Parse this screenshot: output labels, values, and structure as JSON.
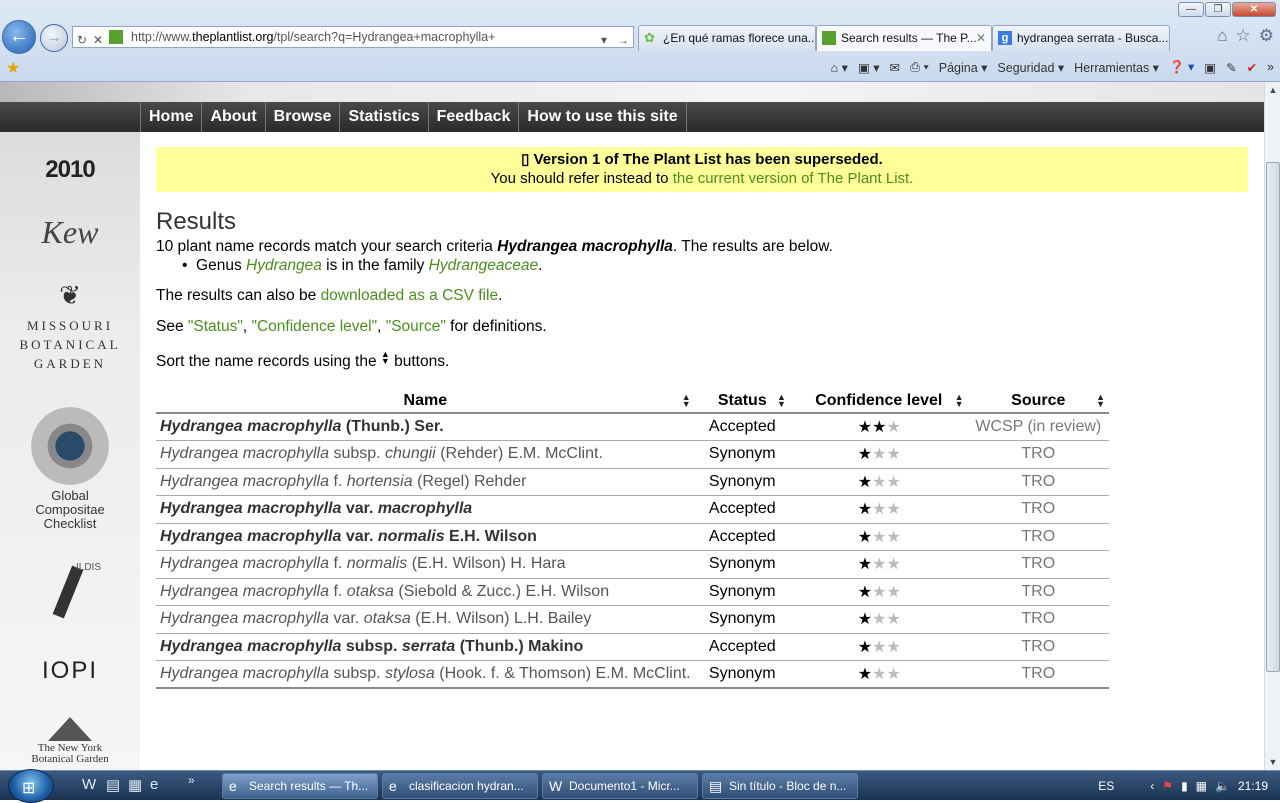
{
  "browser": {
    "url_prefix": "http://www.",
    "url_domain": "theplantlist.org",
    "url_path": "/tpl/search?q=Hydrangea+macrophylla+",
    "tabs": [
      {
        "title": "¿En qué ramas florece una..."
      },
      {
        "title": "Search results — The P...",
        "active": true
      },
      {
        "title": "hydrangea serrata - Busca..."
      }
    ],
    "commands": [
      "Página",
      "Seguridad",
      "Herramientas"
    ]
  },
  "nav": {
    "items": [
      "Home",
      "About",
      "Browse",
      "Statistics",
      "Feedback",
      "How to use this site"
    ]
  },
  "sidebar": {
    "logo_2010": "2010",
    "logo_kew": "Kew",
    "logo_missouri_1": "Missouri",
    "logo_missouri_2": "Botanical",
    "logo_missouri_3": "Garden",
    "logo_gcc": "Global Compositae Checklist",
    "logo_ildis": "ILDIS",
    "logo_iopi": "IOPI",
    "logo_nybg_1": "The New York",
    "logo_nybg_2": "Botanical Garden"
  },
  "notice": {
    "line1": "Version 1 of The Plant List has been superseded.",
    "line2_prefix": "You should refer instead to ",
    "line2_link": "the current version of The Plant List."
  },
  "results": {
    "heading": "Results",
    "summary_prefix": "10 plant name records match your search criteria ",
    "summary_query": "Hydrangea macrophylla",
    "summary_suffix": ". The results are below.",
    "bullet_prefix": "Genus ",
    "bullet_genus": "Hydrangea",
    "bullet_middle": " is in the family ",
    "bullet_family": "Hydrangeaceae",
    "bullet_suffix": ".",
    "csv_prefix": "The results can also be ",
    "csv_link": "downloaded as a CSV file",
    "csv_suffix": ".",
    "see_prefix": "See ",
    "def_status": "\"Status\"",
    "def_sep1": ", ",
    "def_confidence": "\"Confidence level\"",
    "def_sep2": ", ",
    "def_source": "\"Source\"",
    "see_suffix": " for definitions.",
    "sort_prefix": "Sort the name records using the ",
    "sort_suffix": " buttons."
  },
  "table": {
    "headers": {
      "name": "Name",
      "status": "Status",
      "confidence": "Confidence level",
      "source": "Source"
    },
    "rows": [
      {
        "genus_sp": "Hydrangea macrophylla",
        "rank": "",
        "infra": "",
        "author": "(Thunb.) Ser.",
        "status": "Accepted",
        "stars": 2,
        "source": "WCSP (in review)"
      },
      {
        "genus_sp": "Hydrangea macrophylla",
        "rank": "subsp.",
        "infra": "chungii",
        "author": "(Rehder) E.M. McClint.",
        "status": "Synonym",
        "stars": 1,
        "source": "TRO"
      },
      {
        "genus_sp": "Hydrangea macrophylla",
        "rank": "f.",
        "infra": "hortensia",
        "author": "(Regel) Rehder",
        "status": "Synonym",
        "stars": 1,
        "source": "TRO"
      },
      {
        "genus_sp": "Hydrangea macrophylla",
        "rank": "var.",
        "infra": "macrophylla",
        "author": "",
        "status": "Accepted",
        "stars": 1,
        "source": "TRO"
      },
      {
        "genus_sp": "Hydrangea macrophylla",
        "rank": "var.",
        "infra": "normalis",
        "author": "E.H. Wilson",
        "status": "Accepted",
        "stars": 1,
        "source": "TRO"
      },
      {
        "genus_sp": "Hydrangea macrophylla",
        "rank": "f.",
        "infra": "normalis",
        "author": "(E.H. Wilson) H. Hara",
        "status": "Synonym",
        "stars": 1,
        "source": "TRO"
      },
      {
        "genus_sp": "Hydrangea macrophylla",
        "rank": "f.",
        "infra": "otaksa",
        "author": "(Siebold & Zucc.) E.H. Wilson",
        "status": "Synonym",
        "stars": 1,
        "source": "TRO"
      },
      {
        "genus_sp": "Hydrangea macrophylla",
        "rank": "var.",
        "infra": "otaksa",
        "author": "(E.H. Wilson) L.H. Bailey",
        "status": "Synonym",
        "stars": 1,
        "source": "TRO"
      },
      {
        "genus_sp": "Hydrangea macrophylla",
        "rank": "subsp.",
        "infra": "serrata",
        "author": "(Thunb.) Makino",
        "status": "Accepted",
        "stars": 1,
        "source": "TRO"
      },
      {
        "genus_sp": "Hydrangea macrophylla",
        "rank": "subsp.",
        "infra": "stylosa",
        "author": "(Hook. f. & Thomson) E.M. McClint.",
        "status": "Synonym",
        "stars": 1,
        "source": "TRO"
      }
    ]
  },
  "taskbar": {
    "tasks": [
      {
        "label": "Search results — Th...",
        "active": true
      },
      {
        "label": "clasificacion hydran..."
      },
      {
        "label": "Documento1 - Micr..."
      },
      {
        "label": "Sin título - Bloc de n..."
      }
    ],
    "lang": "ES",
    "time": "21:19"
  },
  "colors": {
    "link": "#4b8f1f",
    "notice_bg": "#ffff99",
    "nav_bg": "#333333"
  }
}
